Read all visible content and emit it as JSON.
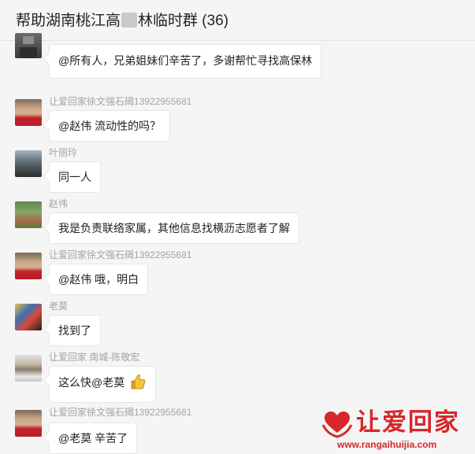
{
  "header": {
    "title_prefix": "帮助湖南桃江高",
    "title_suffix": "林临时群 (36)"
  },
  "messages": [
    {
      "sender": "",
      "text": "@所有人，兄弟姐妹们辛苦了，多谢帮忙寻找高保林",
      "avatar": "avatar-partial"
    },
    {
      "sender": "让爱回家徐文强石碣13922955681",
      "text": "@赵伟 流动性的吗？",
      "avatar": "avatar-red-shirt"
    },
    {
      "sender": "叶丽玲",
      "text": "同一人",
      "avatar": "avatar-dark-photo"
    },
    {
      "sender": "赵伟",
      "text": "我是负责联络家属，其他信息找横沥志愿者了解",
      "avatar": "avatar-scenery"
    },
    {
      "sender": "让爱回家徐文强石碣13922955681",
      "text": "@赵伟 哦，明白",
      "avatar": "avatar-red-shirt"
    },
    {
      "sender": "老莫",
      "text": "找到了",
      "avatar": "avatar-colorful"
    },
    {
      "sender": "让爱回家 南城-陈敬宏",
      "text": "这么快@老莫",
      "avatar": "avatar-man",
      "emoji": "thumbs-up-icon"
    },
    {
      "sender": "让爱回家徐文强石碣13922955681",
      "text": "@老莫 辛苦了",
      "avatar": "avatar-red-shirt"
    }
  ],
  "watermark": {
    "brand": "让爱回家",
    "url": "www.rangaihuijia.com",
    "color": "#d9262a"
  },
  "colors": {
    "background": "#f5f5f5",
    "bubble": "#ffffff",
    "sender": "#a3a3a3"
  }
}
